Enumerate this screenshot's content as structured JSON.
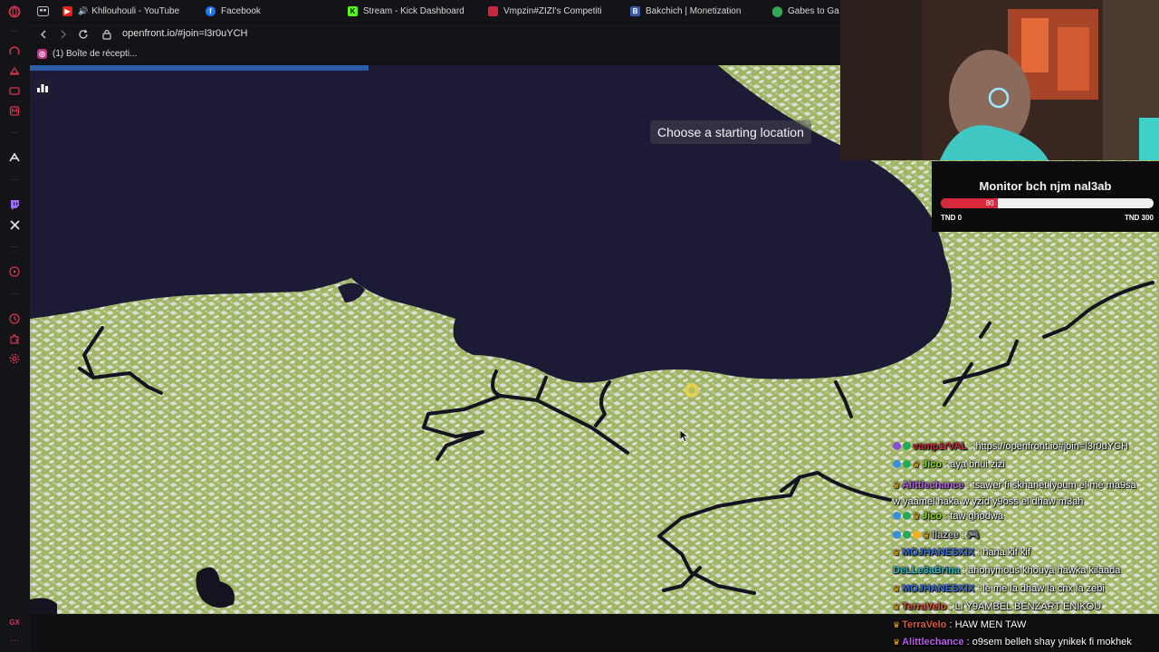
{
  "browser": {
    "tabs": [
      {
        "label": "Khllouhouli - YouTube",
        "favicon": "youtube-icon",
        "color": "#e62117"
      },
      {
        "label": "Facebook",
        "favicon": "facebook-icon",
        "color": "#1877f2"
      },
      {
        "label": "Stream - Kick Dashboard",
        "favicon": "kick-icon",
        "color": "#53fc18"
      },
      {
        "label": "Vmpzin#ZIZI's Competiti",
        "favicon": "competitions-icon",
        "color": "#c8283c"
      },
      {
        "label": "Bakchich | Monetization",
        "favicon": "bakchich-icon",
        "color": "#3b5ba9"
      },
      {
        "label": "Gabes to Ga",
        "favicon": "maps-pin-icon",
        "color": "#34a853"
      }
    ],
    "url": "openfront.io/#join=l3r0uYCH",
    "bookmark": "(1) Boîte de récepti..."
  },
  "game": {
    "hint": "Choose a starting location",
    "loading_progress": 0.3
  },
  "monitor": {
    "title": "Monitor bch njm nal3ab",
    "current_label": "80",
    "current": 80,
    "max": 300,
    "min_label": "TND 0",
    "max_label": "TND 300",
    "bar_color": "#d7283c"
  },
  "chat": [
    {
      "user": "vamp1rVAL",
      "color": "#c8283c",
      "text": " : https://openfront.io#join=l3r0uYCH",
      "badges": [
        "#8a4bd6",
        "#22aa55"
      ],
      "crowns": 0
    },
    {
      "user": "Jico",
      "color": "#8fdc2a",
      "text": " : aya bnui zizi",
      "badges": [
        "#3a8fd8",
        "#22aa55"
      ],
      "crowns": 1
    },
    {
      "user": "Alittlechance",
      "color": "#b75fe8",
      "text": " : tsawer fi skhanet lyoum el mé ma9sa",
      "text2": "w yaamel haka w yzid y9oss el dhaw m3ah",
      "badges": [],
      "crowns": 1
    },
    {
      "user": "Jico",
      "color": "#8fdc2a",
      "text": " : taw ghodwa",
      "badges": [
        "#3a8fd8",
        "#22aa55"
      ],
      "crowns": 1
    },
    {
      "user": "llazee",
      "color": "#bbbbbb",
      "text": " : 🎮",
      "badges": [
        "#3a8fd8",
        "#22aa55",
        "#f2b01e"
      ],
      "crowns": 1
    },
    {
      "user": "MOJHANESXIX",
      "color": "#3a6ed8",
      "text": " : hana kif kif",
      "badges": [],
      "crowns": 1
    },
    {
      "user": "DeLLe3aBrina",
      "color": "#2fb8c4",
      "text": " : anonymous khouya hawka kilaada",
      "badges": [],
      "crowns": 0
    },
    {
      "user": "MOJHANESXIX",
      "color": "#3a6ed8",
      "text": " : le me la dhaw la cnx la zebi",
      "badges": [],
      "crowns": 1
    },
    {
      "user": "TerraVelo",
      "color": "#e2563a",
      "text": " : LI Y9AMBEL BENZART ENIKOU",
      "badges": [],
      "crowns": 1
    },
    {
      "user": "TerraVelo",
      "color": "#e2563a",
      "text": " : HAW MEN TAW",
      "badges": [],
      "crowns": 1
    },
    {
      "user": "Alittlechance",
      "color": "#b75fe8",
      "text": " : o9sem belleh shay ynikek fi mokhek",
      "badges": [],
      "crowns": 1
    }
  ]
}
